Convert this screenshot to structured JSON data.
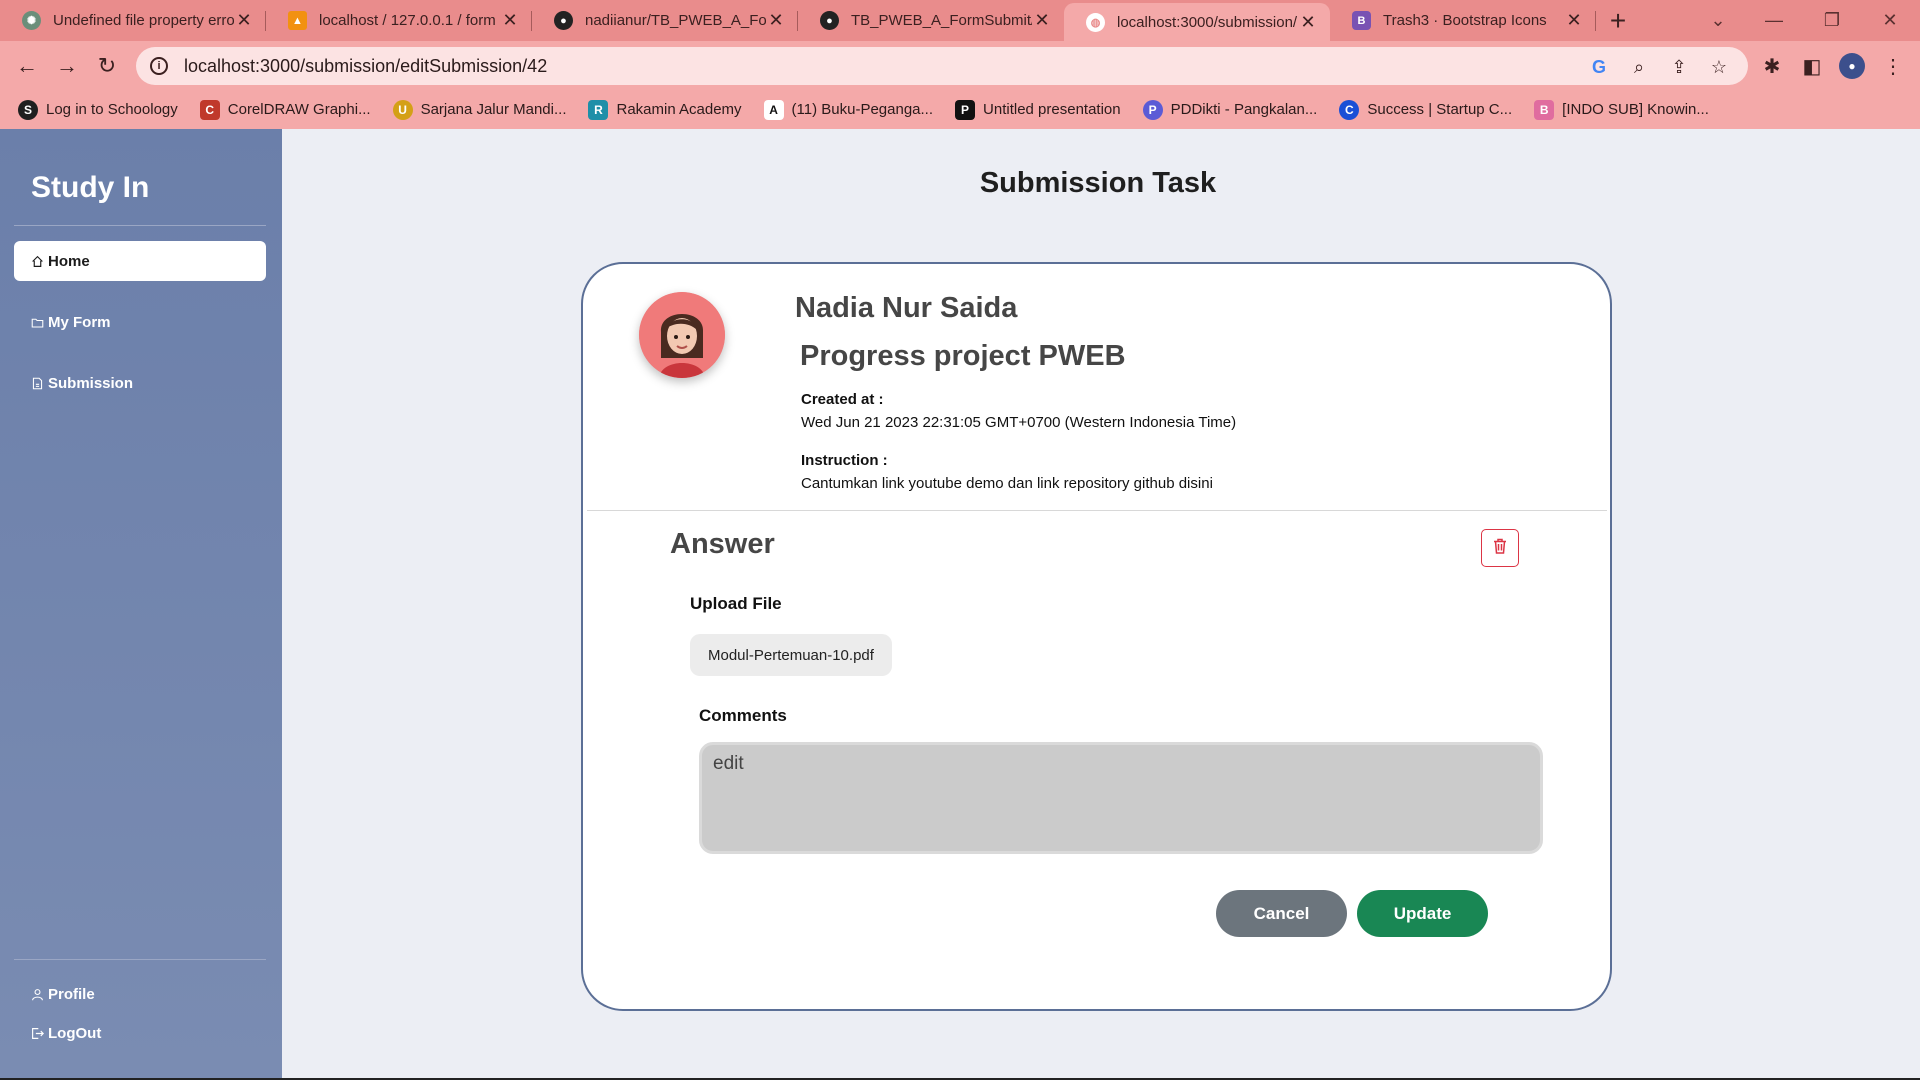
{
  "browser": {
    "tabs": [
      {
        "title": "Undefined file property erro",
        "icon": "chatgpt-icon",
        "color": "#6b8e7a"
      },
      {
        "title": "localhost / 127.0.0.1 / form",
        "icon": "phpmyadmin-icon",
        "color": "#f29111"
      },
      {
        "title": "nadiianur/TB_PWEB_A_Form",
        "icon": "github-icon",
        "color": "#222222"
      },
      {
        "title": "TB_PWEB_A_FormSubmit/v",
        "icon": "github-icon",
        "color": "#222222"
      },
      {
        "title": "localhost:3000/submission/",
        "icon": "globe-icon",
        "color": "#ffffff"
      },
      {
        "title": "Trash3 · Bootstrap Icons",
        "icon": "bootstrap-icon",
        "color": "#7952b3"
      }
    ],
    "active_tab": 4,
    "url": "localhost:3000/submission/editSubmission/42",
    "bookmarks": [
      {
        "title": "Log in to Schoology",
        "icon": "schoology-icon",
        "color": "#1f1f1f",
        "glyph": "S"
      },
      {
        "title": "CorelDRAW Graphi...",
        "icon": "coreldraw-icon",
        "color": "#c0392b",
        "glyph": "C"
      },
      {
        "title": "Sarjana Jalur Mandi...",
        "icon": "university-icon",
        "color": "#d4a017",
        "glyph": "U"
      },
      {
        "title": "Rakamin Academy",
        "icon": "rakamin-icon",
        "color": "#1e8fa8",
        "glyph": "R"
      },
      {
        "title": "(11) Buku-Peganga...",
        "icon": "academia-icon",
        "color": "#111111",
        "glyph": "A"
      },
      {
        "title": "Untitled presentation",
        "icon": "pitch-icon",
        "color": "#111111",
        "glyph": "P"
      },
      {
        "title": "PDDikti - Pangkalan...",
        "icon": "pddikti-icon",
        "color": "#5b5bd6",
        "glyph": "P"
      },
      {
        "title": "Success | Startup C...",
        "icon": "startup-icon",
        "color": "#1a4fd6",
        "glyph": "C"
      },
      {
        "title": "[INDO SUB] Knowin...",
        "icon": "bilibili-icon",
        "color": "#e06c9f",
        "glyph": "B"
      }
    ]
  },
  "sidebar": {
    "brand": "Study In",
    "items": [
      {
        "label": "Home",
        "icon": "house-icon",
        "active": true
      },
      {
        "label": "My Form",
        "icon": "folder-icon",
        "active": false
      },
      {
        "label": "Submission",
        "icon": "file-icon",
        "active": false
      }
    ],
    "bottom_items": [
      {
        "label": "Profile",
        "icon": "person-icon"
      },
      {
        "label": "LogOut",
        "icon": "logout-icon"
      }
    ]
  },
  "main": {
    "page_title": "Submission Task",
    "user_name": "Nadia Nur Saida",
    "task_title": "Progress project PWEB",
    "created_label": "Created at :",
    "created_value": "Wed Jun 21 2023 22:31:05 GMT+0700 (Western Indonesia Time)",
    "instruction_label": "Instruction :",
    "instruction_value": "Cantumkan link youtube demo dan link repository github disini",
    "answer_heading": "Answer",
    "upload_label": "Upload File",
    "file_name": "Modul-Pertemuan-10.pdf",
    "comments_label": "Comments",
    "comments_value": "edit",
    "cancel_label": "Cancel",
    "update_label": "Update"
  },
  "colors": {
    "tabstrip": "#e98c8c",
    "sidebar": "#6b7faa",
    "cancel": "#6c757d",
    "update": "#198754",
    "delete": "#dc3545"
  }
}
